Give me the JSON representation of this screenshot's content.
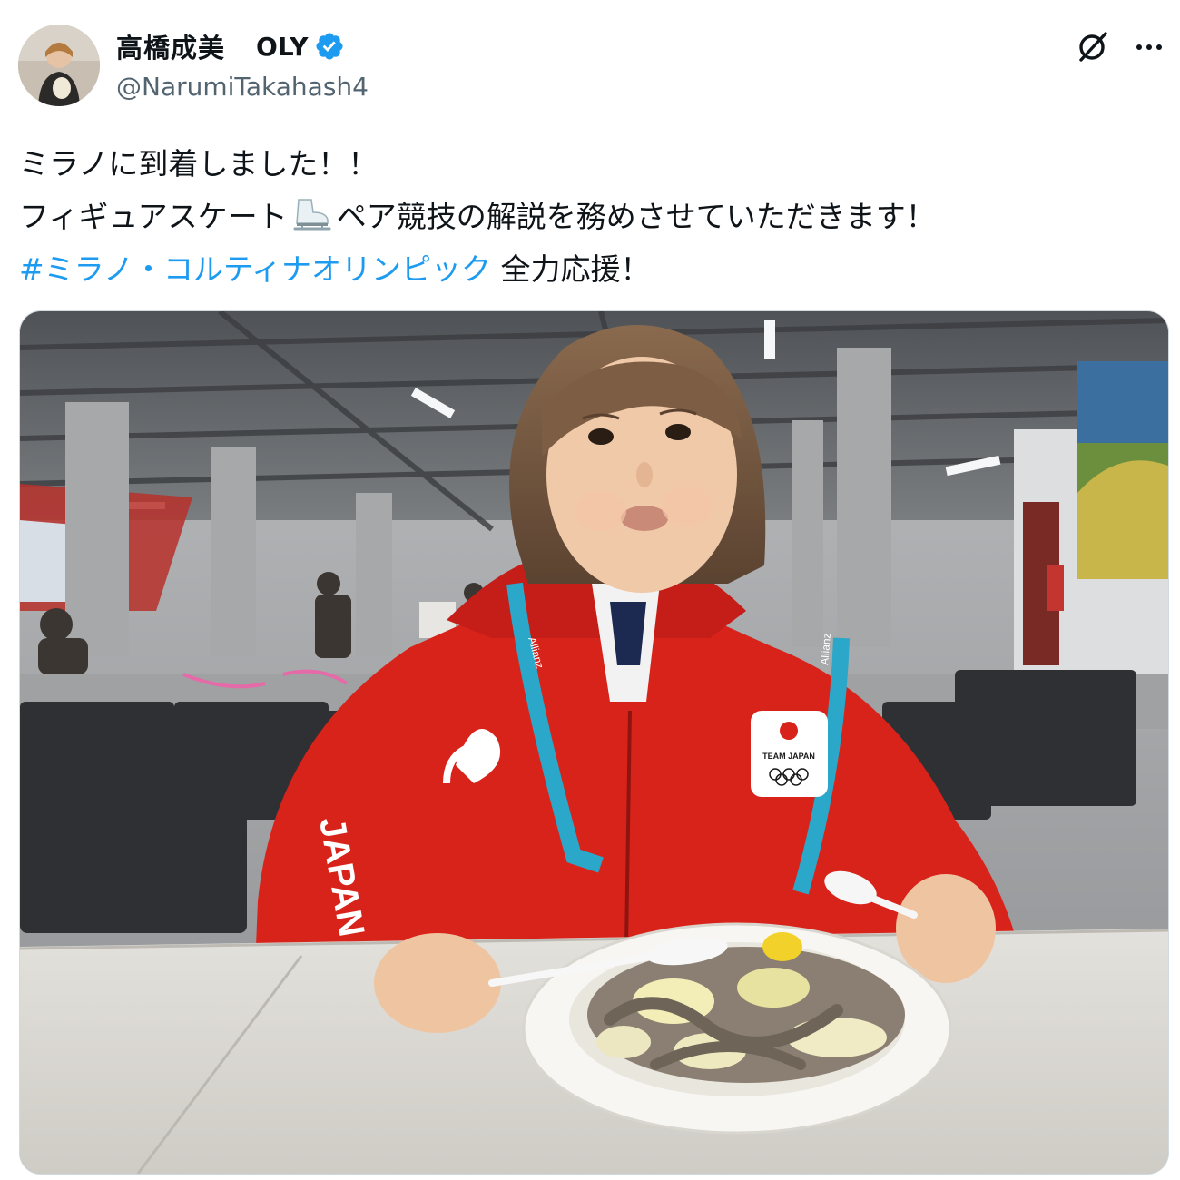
{
  "author": {
    "display_name": "高橋成美",
    "name_tag": "OLY",
    "handle": "@NarumiTakahash4",
    "verified_icon": "verified-badge-icon",
    "avatar_icon": "profile-avatar"
  },
  "header_actions": {
    "grok_icon": "grok-icon",
    "more_icon": "more-options-icon"
  },
  "tweet": {
    "line1": "ミラノに到着しました！！",
    "line2_before": "フィギュアスケート",
    "line2_emoji": "ice-skate-emoji",
    "line2_after": "ペア競技の解説を務めさせていただきます！",
    "hashtag": "#ミラノ・コルティナオリンピック",
    "line3_after": " 全力応援！"
  },
  "photo": {
    "jacket_text": "TEAM JAPAN",
    "lanyard_text": "Allianz",
    "jacket_side_text": "JAPAN",
    "colors": {
      "jacket": "#d8231b",
      "lanyard": "#2aa7c9",
      "floor": "#d7d5d0"
    }
  },
  "colors": {
    "link": "#1d9bf0",
    "verified": "#1d9bf0",
    "secondary": "#536471"
  }
}
